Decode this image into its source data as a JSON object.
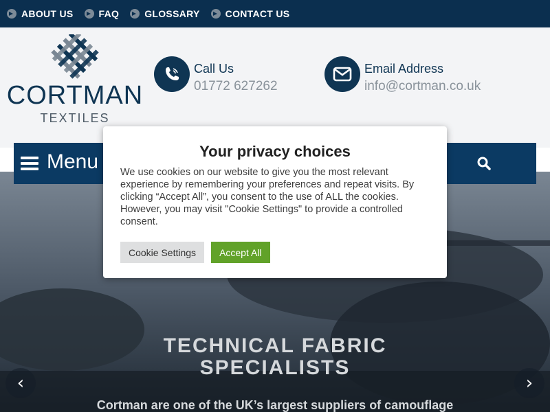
{
  "topnav": {
    "items": [
      {
        "label": "ABOUT US"
      },
      {
        "label": "FAQ"
      },
      {
        "label": "GLOSSARY"
      },
      {
        "label": "CONTACT US"
      }
    ]
  },
  "header": {
    "logo_name": "CORTMAN",
    "logo_sub": "TEXTILES",
    "call": {
      "title": "Call Us",
      "value": "01772 627262",
      "icon": "phone-icon"
    },
    "email": {
      "title": "Email Address",
      "value": "info@cortman.co.uk",
      "icon": "envelope-icon"
    }
  },
  "menubar": {
    "label": "Menu",
    "search_icon": "search-icon"
  },
  "hero": {
    "title_line1": "TECHNICAL FABRIC",
    "title_line2": "SPECIALISTS",
    "subtitle": "Cortman are one of the UK’s largest suppliers of camouflage",
    "prev_glyph": "‹",
    "next_glyph": "›"
  },
  "cookie_dialog": {
    "title": "Your privacy choices",
    "body": "We use cookies on our website to give you the most relevant experience by remembering your preferences and repeat visits. By clicking “Accept All”, you consent to the use of ALL the cookies. However, you may visit \"Cookie Settings\" to provide a controlled consent.",
    "settings_label": "Cookie Settings",
    "accept_label": "Accept All"
  },
  "colors": {
    "brand_navy": "#0b3a63",
    "accept_green": "#61a229"
  }
}
